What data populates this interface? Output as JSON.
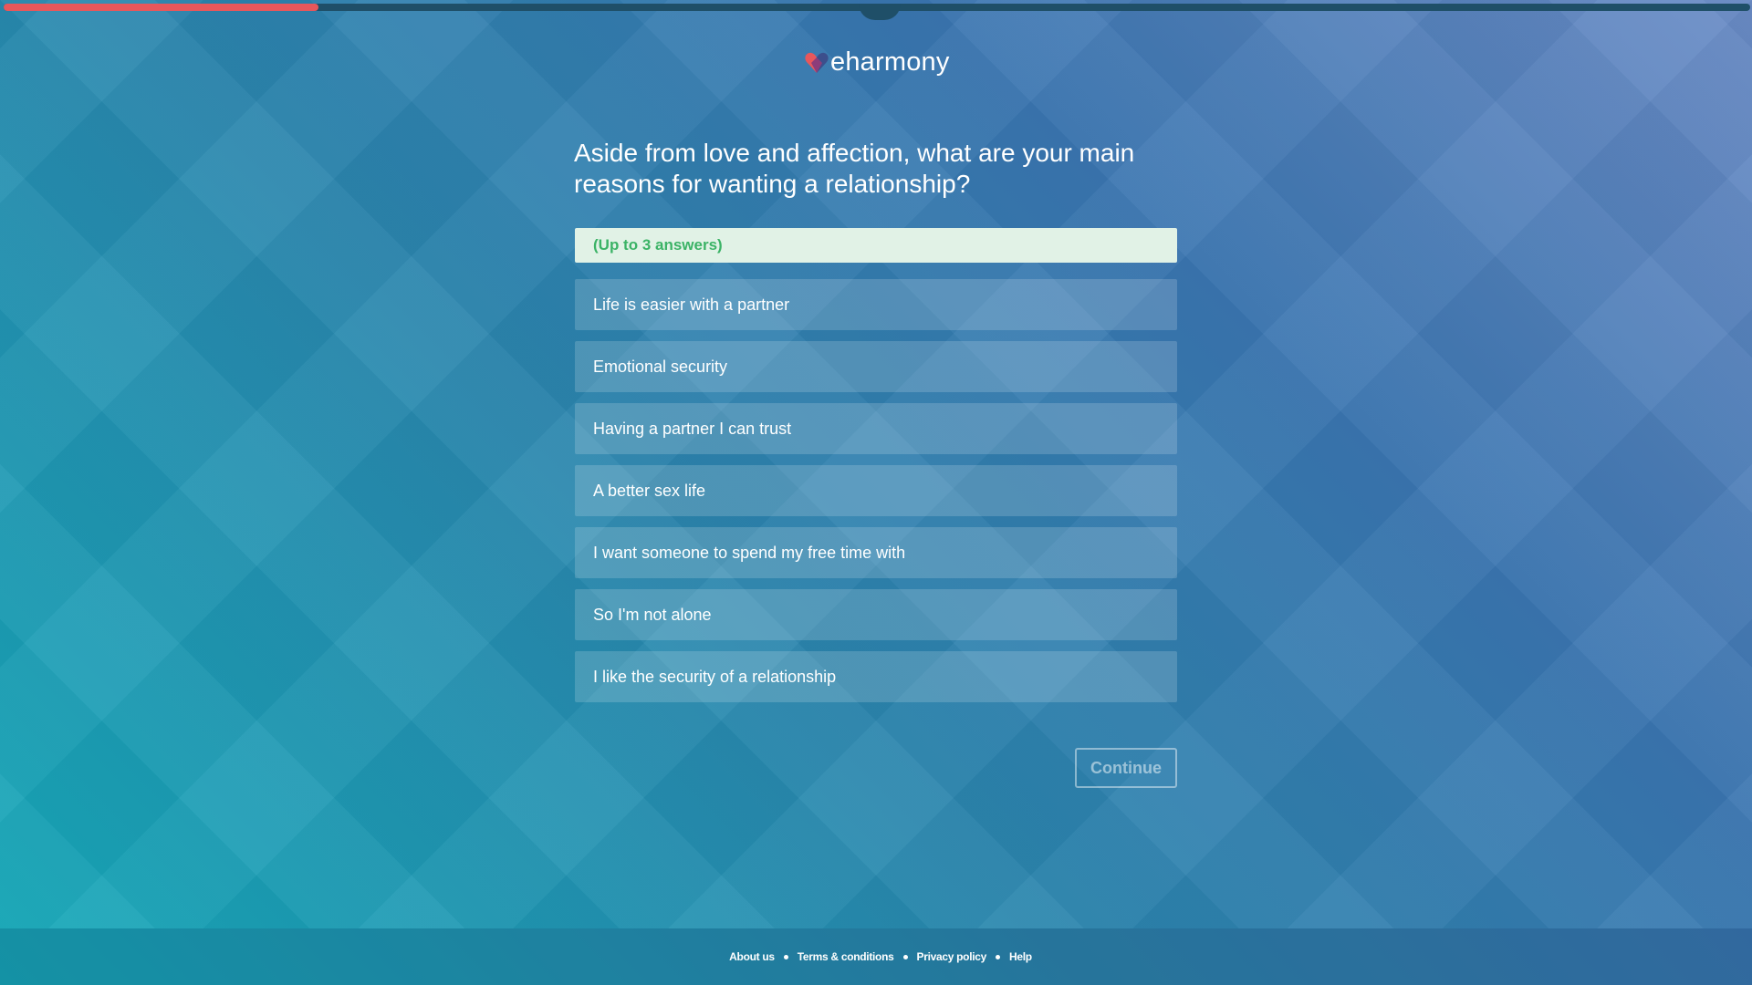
{
  "progress": {
    "fraction": 0.18
  },
  "brand": {
    "name": "eharmony",
    "heart_icon": "heart-logo-icon"
  },
  "question": {
    "text": "Aside from love and affection, what are your main reasons for wanting a relationship?"
  },
  "hint": {
    "text": "(Up to 3 answers)"
  },
  "options": [
    {
      "label": "Life is easier with a partner"
    },
    {
      "label": "Emotional security"
    },
    {
      "label": "Having a partner I can trust"
    },
    {
      "label": "A better sex life"
    },
    {
      "label": "I want someone to spend my free time with"
    },
    {
      "label": "So I'm not alone"
    },
    {
      "label": "I like the security of a relationship"
    }
  ],
  "actions": {
    "continue_label": "Continue"
  },
  "footer": {
    "links": [
      {
        "label": "About us"
      },
      {
        "label": "Terms & conditions"
      },
      {
        "label": "Privacy policy"
      },
      {
        "label": "Help"
      }
    ]
  },
  "colors": {
    "progress_fill": "#e8575b",
    "progress_track": "#1f4f68",
    "hint_text": "#3bb366",
    "hint_background": "#e1f2e6"
  }
}
